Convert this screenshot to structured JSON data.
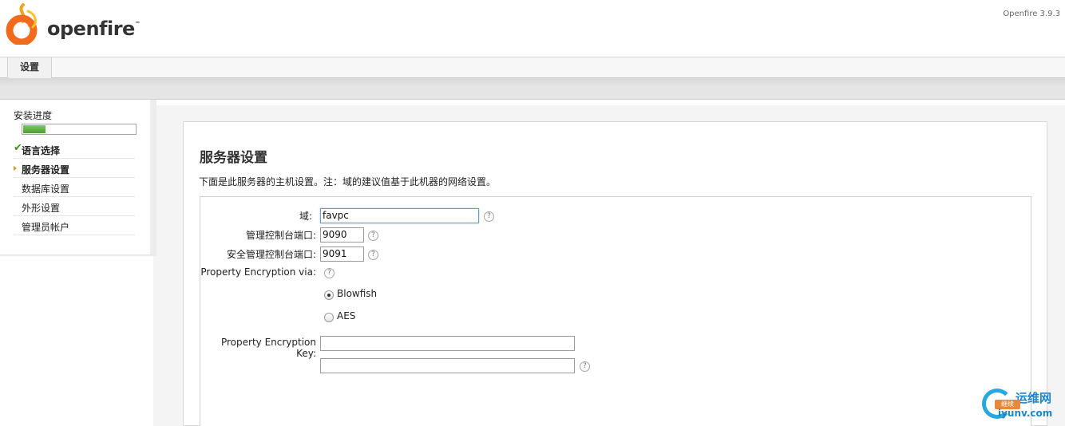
{
  "header": {
    "logo_text": "openfire",
    "logo_tm": "™",
    "version": "Openfire 3.9.3"
  },
  "tabs": [
    {
      "label": "设置"
    }
  ],
  "sidebar": {
    "title": "安装进度",
    "progress": 0.2,
    "items": [
      {
        "label": "语言选择",
        "status": "done"
      },
      {
        "label": "服务器设置",
        "status": "current"
      },
      {
        "label": "数据库设置",
        "status": "pending"
      },
      {
        "label": "外形设置",
        "status": "pending"
      },
      {
        "label": "管理员帐户",
        "status": "pending"
      }
    ]
  },
  "main": {
    "title": "服务器设置",
    "description": "下面是此服务器的主机设置。注：域的建议值基于此机器的网络设置。",
    "form": {
      "domain_label": "域:",
      "domain_value": "favpc",
      "admin_port_label": "管理控制台端口:",
      "admin_port_value": "9090",
      "secure_port_label": "安全管理控制台端口:",
      "secure_port_value": "9091",
      "encryption_label": "Property Encryption via:",
      "encryption_options": [
        {
          "label": "Blowfish",
          "checked": true
        },
        {
          "label": "AES",
          "checked": false
        }
      ],
      "key_label": "Property Encryption Key:",
      "key_value": "",
      "key_confirm_value": "",
      "help_glyph": "?"
    }
  },
  "watermark": {
    "title": "运维网",
    "url": "iyunv.com",
    "button": "继续"
  },
  "colors": {
    "progress_fill": "#5fae3f",
    "check": "#4a8a2a",
    "arrow": "#d49b23",
    "logo_orange": "#f26b1d"
  }
}
